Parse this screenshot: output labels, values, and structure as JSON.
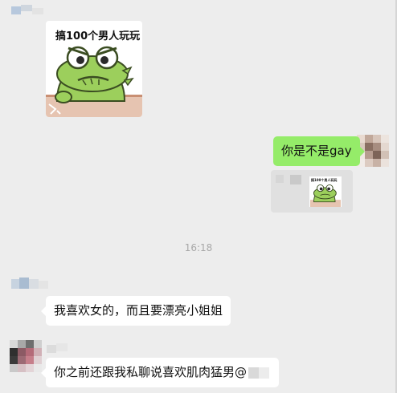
{
  "chat": {
    "messages": [
      {
        "side": "left",
        "type": "sticker",
        "caption": "搞100个男人玩玩"
      },
      {
        "side": "right",
        "type": "text",
        "text": "你是不是gay"
      },
      {
        "side": "right",
        "type": "quote",
        "quoted_caption": "搞100个男人玩玩"
      },
      {
        "side": "center",
        "type": "time",
        "text": "16:18"
      },
      {
        "side": "left",
        "type": "text",
        "text": "我喜欢女的，而且要漂亮小姐姐"
      },
      {
        "side": "left",
        "type": "text",
        "text": "你之前还跟我私聊说喜欢肌肉猛男@"
      }
    ]
  },
  "colors": {
    "background": "#ededed",
    "outgoing_bubble": "#95ec69",
    "incoming_bubble": "#ffffff",
    "frog_green": "#9ccf5c"
  },
  "icons": [
    "frog-sticker",
    "avatar-mosaic",
    "name-mosaic"
  ]
}
